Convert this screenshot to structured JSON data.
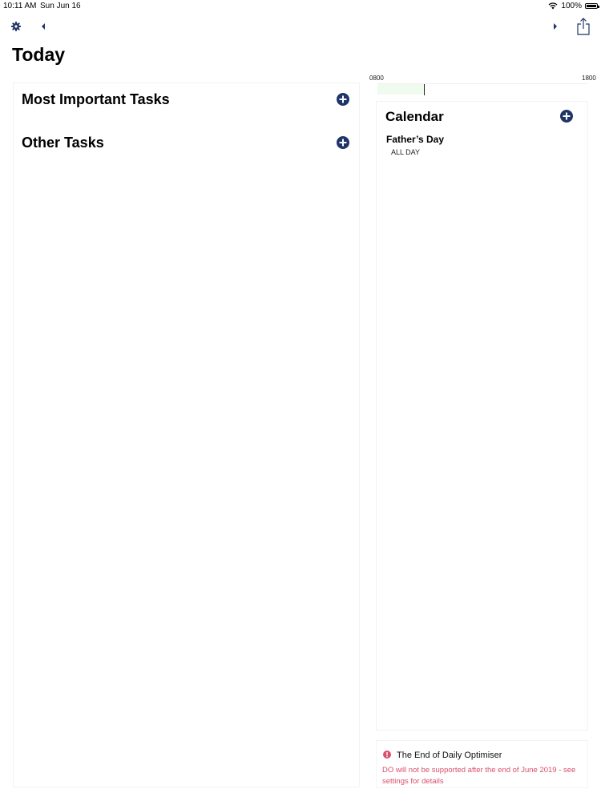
{
  "status_bar": {
    "time": "10:11 AM",
    "date": "Sun Jun 16",
    "battery": "100%"
  },
  "toolbar": {
    "settings_icon": "gear-icon",
    "prev_icon": "triangle-left-icon",
    "next_icon": "triangle-right-icon",
    "share_icon": "share-icon"
  },
  "page": {
    "title": "Today"
  },
  "tasks": {
    "most_important_heading": "Most Important Tasks",
    "other_heading": "Other Tasks"
  },
  "timeline": {
    "start_label": "0800",
    "end_label": "1800",
    "elapsed_fraction": 0.22,
    "now_fraction": 0.22
  },
  "calendar": {
    "heading": "Calendar",
    "events": [
      {
        "title": "Father’s Day",
        "time": "ALL DAY"
      }
    ]
  },
  "notice": {
    "title": "The End of Daily Optimiser",
    "body": "DO will not be supported after the end of June 2019 - see settings for details"
  },
  "colors": {
    "accent": "#1f3568",
    "notice_red": "#d9506d",
    "timeline_fill": "#f0fbef"
  }
}
